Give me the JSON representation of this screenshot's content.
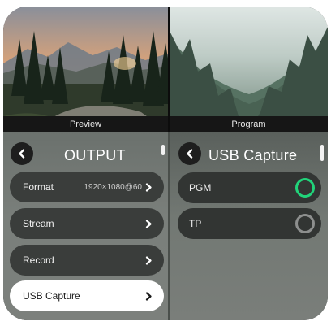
{
  "monitors": {
    "preview_label": "Preview",
    "program_label": "Program"
  },
  "output_panel": {
    "title": "OUTPUT",
    "items": [
      {
        "label": "Format",
        "value": "1920×1080@60"
      },
      {
        "label": "Stream",
        "value": ""
      },
      {
        "label": "Record",
        "value": ""
      },
      {
        "label": "USB Capture",
        "value": "",
        "selected": true
      }
    ]
  },
  "usb_panel": {
    "title": "USB Capture",
    "sources": [
      {
        "label": "PGM",
        "selected": true
      },
      {
        "label": "TP",
        "selected": false
      }
    ]
  },
  "colors": {
    "radio_on": "#21d47a",
    "radio_off": "#8d8f8e",
    "row_bg": "#3a3d3b",
    "row_selected_bg": "#ffffff"
  },
  "icons": [
    "chevron-left-icon",
    "chevron-right-icon",
    "radio-button"
  ]
}
